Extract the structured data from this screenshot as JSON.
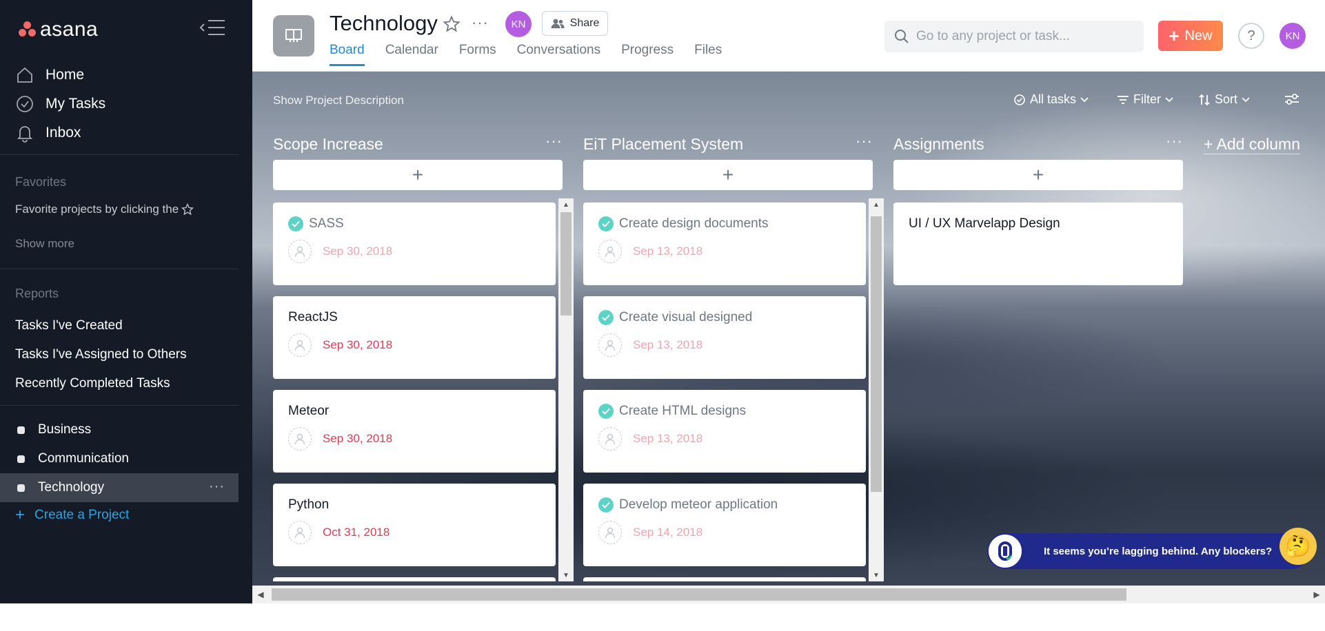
{
  "sidebar": {
    "logo": "asana",
    "nav": [
      {
        "label": "Home",
        "icon": "home-icon"
      },
      {
        "label": "My Tasks",
        "icon": "check-circle-icon"
      },
      {
        "label": "Inbox",
        "icon": "bell-icon"
      }
    ],
    "favorites_title": "Favorites",
    "favorites_hint": "Favorite projects by clicking the",
    "show_more": "Show more",
    "reports_title": "Reports",
    "reports": [
      "Tasks I've Created",
      "Tasks I've Assigned to Others",
      "Recently Completed Tasks"
    ],
    "projects": [
      {
        "label": "Business",
        "active": false
      },
      {
        "label": "Communication",
        "active": false
      },
      {
        "label": "Technology",
        "active": true
      }
    ],
    "project_more": "···",
    "create_project": "Create a Project"
  },
  "header": {
    "project_title": "Technology",
    "more": "···",
    "avatar_initials": "KN",
    "share_label": "Share",
    "tabs": [
      {
        "label": "Board",
        "active": true
      },
      {
        "label": "Calendar",
        "active": false
      },
      {
        "label": "Forms",
        "active": false
      },
      {
        "label": "Conversations",
        "active": false
      },
      {
        "label": "Progress",
        "active": false
      },
      {
        "label": "Files",
        "active": false
      }
    ],
    "search_placeholder": "Go to any project or task...",
    "new_label": "New",
    "help_label": "?",
    "user_initials": "KN"
  },
  "board": {
    "show_description": "Show Project Description",
    "toolbar": {
      "all_tasks": "All tasks",
      "filter": "Filter",
      "sort": "Sort"
    },
    "add_column": "+ Add column",
    "add_card_label": "+",
    "columns": [
      {
        "title": "Scope Increase",
        "cards": [
          {
            "title": "SASS",
            "date": "Sep 30, 2018",
            "done": true
          },
          {
            "title": "ReactJS",
            "date": "Sep 30, 2018",
            "done": false
          },
          {
            "title": "Meteor",
            "date": "Sep 30, 2018",
            "done": false
          },
          {
            "title": "Python",
            "date": "Oct 31, 2018",
            "done": false
          }
        ]
      },
      {
        "title": "EiT Placement System",
        "cards": [
          {
            "title": "Create design documents",
            "date": "Sep 13, 2018",
            "done": true
          },
          {
            "title": "Create visual designed",
            "date": "Sep 13, 2018",
            "done": true
          },
          {
            "title": "Create HTML designs",
            "date": "Sep 13, 2018",
            "done": true
          },
          {
            "title": "Develop meteor application",
            "date": "Sep 14, 2018",
            "done": true
          }
        ]
      },
      {
        "title": "Assignments",
        "cards": [
          {
            "title": "UI / UX Marvelapp Design",
            "date": "",
            "done": false
          }
        ]
      }
    ]
  },
  "toast": {
    "message": "It seems you’re lagging behind. Any blockers?"
  },
  "colors": {
    "sidebar_bg": "#151b26",
    "accent_blue": "#1f8dd6",
    "new_button": "#fc636b",
    "avatar": "#b55de0",
    "check_done": "#5cd3c7",
    "due_date": "#e8384f"
  }
}
